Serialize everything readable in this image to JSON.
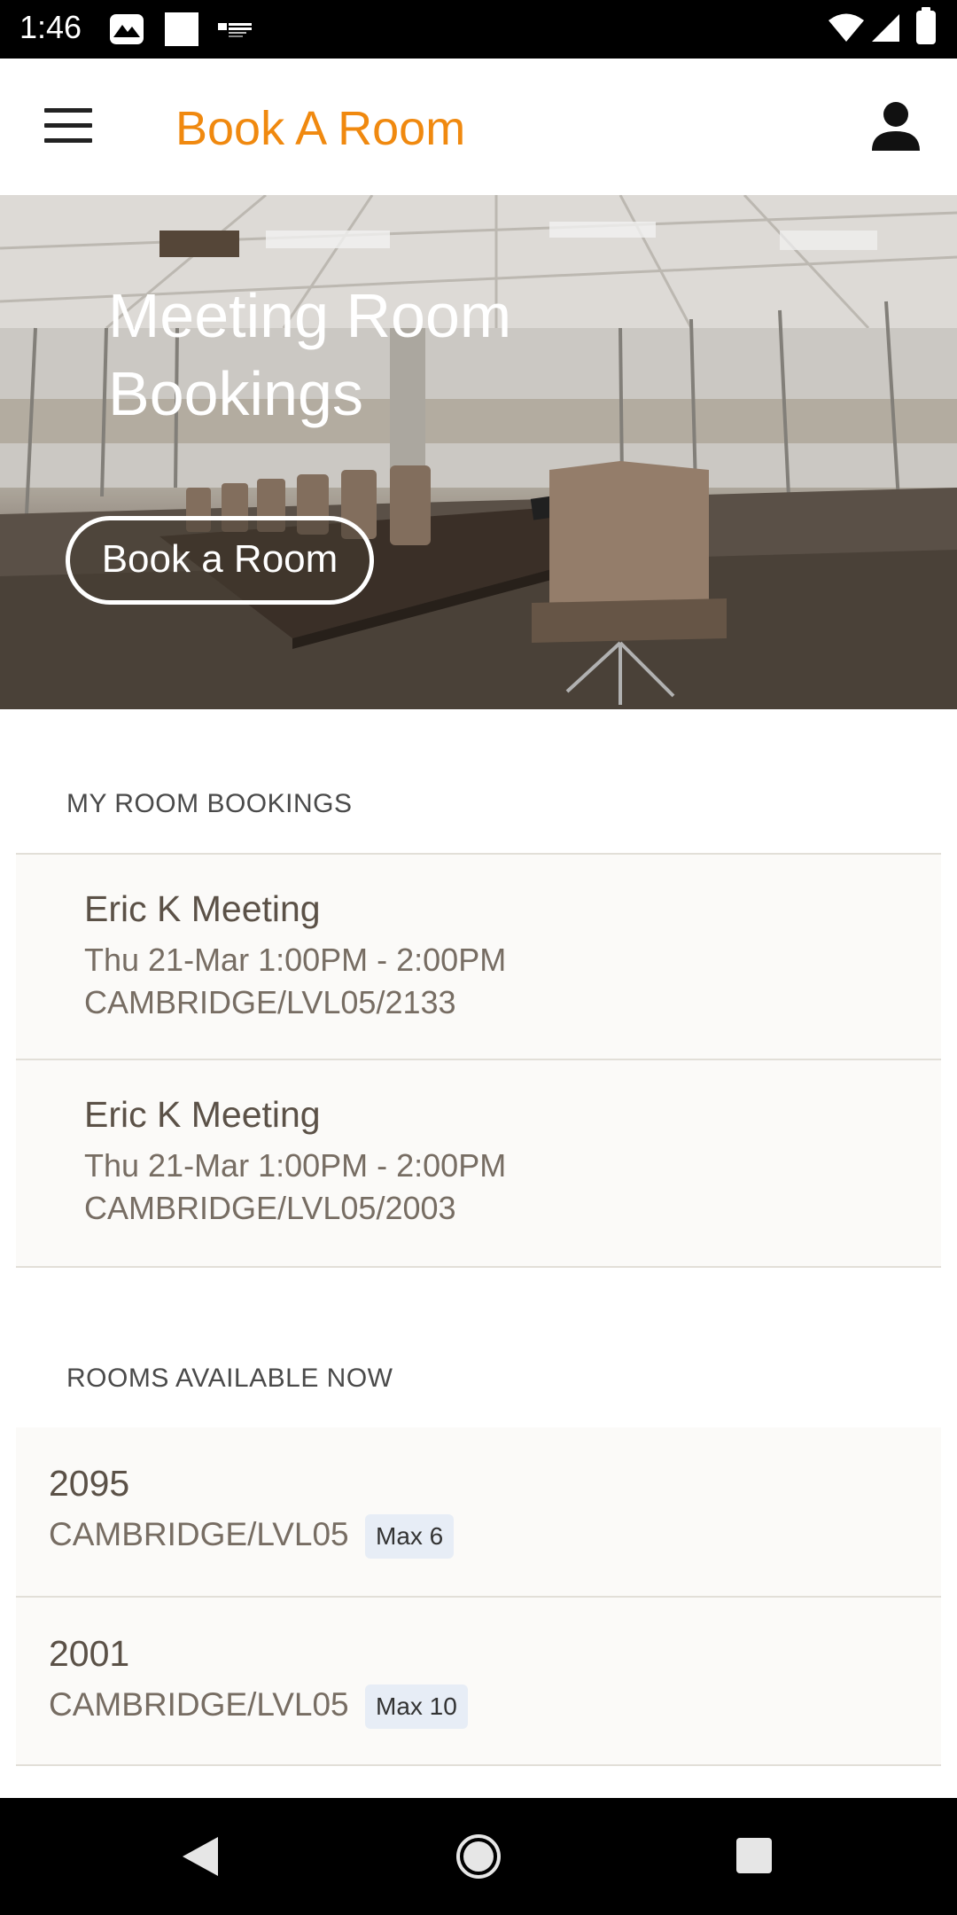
{
  "status_bar": {
    "time": "1:46"
  },
  "app_bar": {
    "title": "Book A Room",
    "title_color": "#f0890f",
    "menu_icon": "hamburger-menu-icon",
    "user_icon": "account-icon"
  },
  "hero": {
    "title": "Meeting Room Bookings",
    "button_label": "Book a Room"
  },
  "my_bookings": {
    "header": "MY ROOM BOOKINGS",
    "items": [
      {
        "title": "Eric K Meeting",
        "time": "Thu 21-Mar 1:00PM - 2:00PM",
        "location": "CAMBRIDGE/LVL05/2133"
      },
      {
        "title": "Eric K Meeting",
        "time": "Thu 21-Mar 1:00PM - 2:00PM",
        "location": "CAMBRIDGE/LVL05/2003"
      }
    ]
  },
  "rooms_available": {
    "header": "ROOMS AVAILABLE NOW",
    "items": [
      {
        "number": "2095",
        "location": "CAMBRIDGE/LVL05",
        "capacity": "Max 6"
      },
      {
        "number": "2001",
        "location": "CAMBRIDGE/LVL05",
        "capacity": "Max 10"
      }
    ]
  },
  "nav_bar": {
    "back_icon": "back-triangle-icon",
    "home_icon": "home-circle-icon",
    "recents_icon": "recents-square-icon"
  }
}
